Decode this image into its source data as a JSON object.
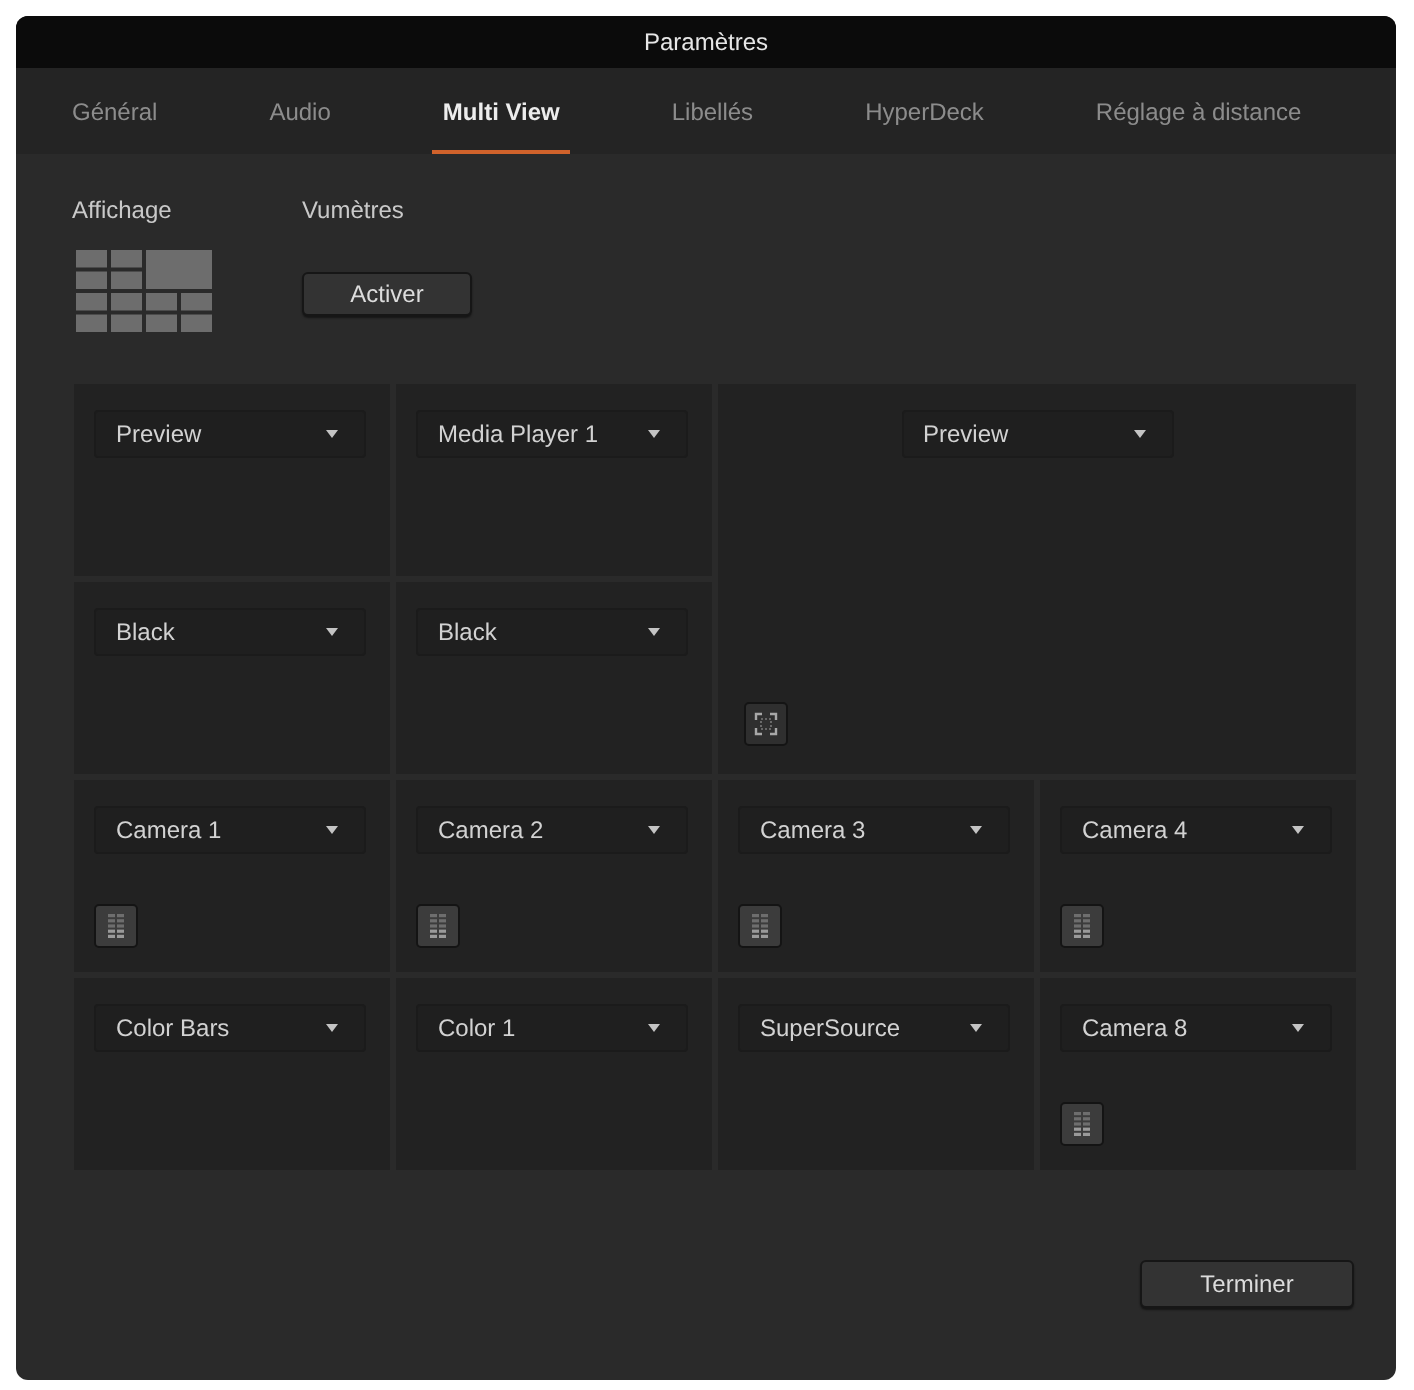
{
  "window": {
    "title": "Paramètres"
  },
  "tabs": [
    {
      "label": "Général",
      "selected": false
    },
    {
      "label": "Audio",
      "selected": false
    },
    {
      "label": "Multi View",
      "selected": true
    },
    {
      "label": "Libellés",
      "selected": false
    },
    {
      "label": "HyperDeck",
      "selected": false
    },
    {
      "label": "Réglage à distance",
      "selected": false
    }
  ],
  "display": {
    "label": "Affichage"
  },
  "audio_meters": {
    "label": "Vumètres",
    "button": "Activer"
  },
  "views": [
    {
      "kind": "small",
      "source": "Preview"
    },
    {
      "kind": "small",
      "source": "Media Player 1"
    },
    {
      "kind": "large",
      "source": "Preview",
      "button": {
        "kind": "safe_area"
      }
    },
    {
      "kind": "small",
      "source": "Black"
    },
    {
      "kind": "small",
      "source": "Black"
    },
    {
      "kind": "small",
      "source": "Camera 1",
      "button": {
        "kind": "audio_meter"
      }
    },
    {
      "kind": "small",
      "source": "Camera 2",
      "button": {
        "kind": "audio_meter"
      }
    },
    {
      "kind": "small",
      "source": "Camera 3",
      "button": {
        "kind": "audio_meter"
      }
    },
    {
      "kind": "small",
      "source": "Camera 4",
      "button": {
        "kind": "audio_meter"
      }
    },
    {
      "kind": "small",
      "source": "Color Bars"
    },
    {
      "kind": "small",
      "source": "Color 1"
    },
    {
      "kind": "small",
      "source": "SuperSource"
    },
    {
      "kind": "small",
      "source": "Camera 8",
      "button": {
        "kind": "audio_meter"
      }
    }
  ],
  "done_button": "Terminer"
}
